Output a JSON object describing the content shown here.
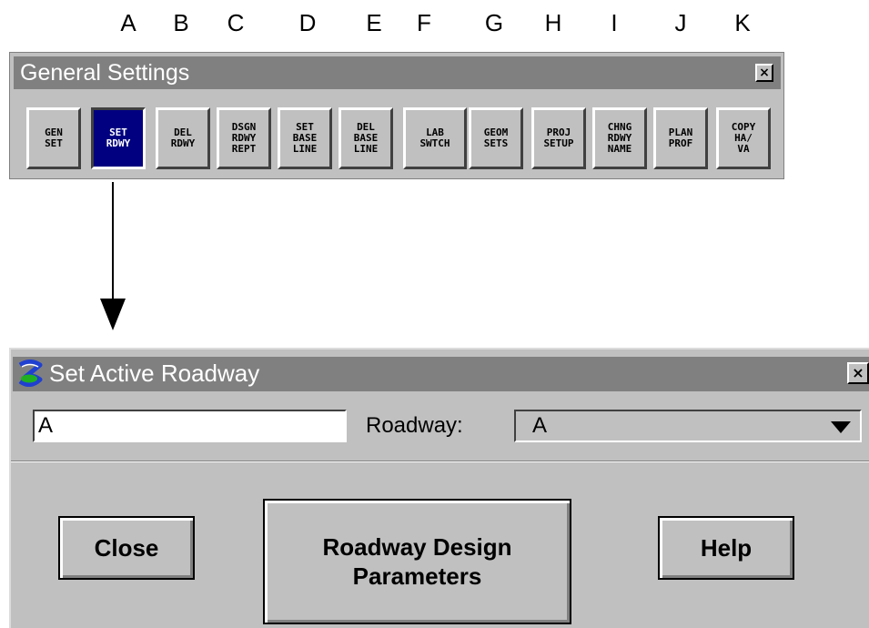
{
  "column_letters": [
    "A",
    "B",
    "C",
    "D",
    "E",
    "F",
    "G",
    "H",
    "I",
    "J",
    "K"
  ],
  "palette": {
    "title": "General Settings",
    "close_glyph": "×",
    "buttons": [
      {
        "label": "GEN\nSET",
        "active": false
      },
      {
        "label": "SET\nRDWY",
        "active": true
      },
      {
        "label": "DEL\nRDWY",
        "active": false
      },
      {
        "label": "DSGN\nRDWY\nREPT",
        "active": false
      },
      {
        "label": "SET\nBASE\nLINE",
        "active": false
      },
      {
        "label": "DEL\nBASE\nLINE",
        "active": false
      },
      {
        "label": "LAB\nSWTCH",
        "active": false
      },
      {
        "label": "GEOM\nSETS",
        "active": false
      },
      {
        "label": "PROJ\nSETUP",
        "active": false
      },
      {
        "label": "CHNG\nRDWY\nNAME",
        "active": false
      },
      {
        "label": "PLAN\nPROF",
        "active": false
      },
      {
        "label": "COPY\nHA/\nVA",
        "active": false
      }
    ]
  },
  "dialog": {
    "title": "Set Active Roadway",
    "icon": "app-logo-icon",
    "close_glyph": "×",
    "text_field_value": "A",
    "roadway_label": "Roadway:",
    "roadway_selected": "A",
    "close_label": "Close",
    "params_label": "Roadway Design\nParameters",
    "help_label": "Help"
  },
  "colors": {
    "title_bar": "#808080",
    "panel": "#c0c0c0",
    "active_button": "#000080"
  }
}
